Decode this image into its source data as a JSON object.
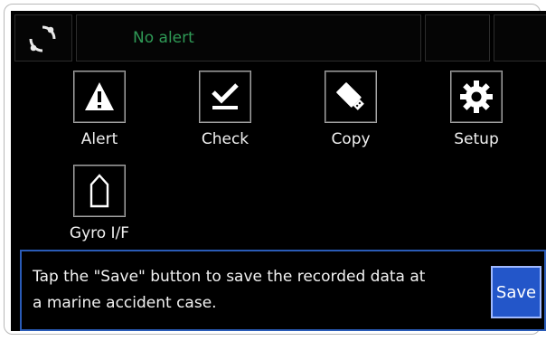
{
  "topbar": {
    "status_icon": "sync-indicator-icon",
    "alert_text": "No alert"
  },
  "menu": {
    "items": [
      {
        "label": "Alert",
        "icon": "warning-triangle-icon"
      },
      {
        "label": "Check",
        "icon": "checkmark-icon"
      },
      {
        "label": "Copy",
        "icon": "usb-drive-icon"
      },
      {
        "label": "Setup",
        "icon": "gear-icon"
      },
      {
        "label": "Gyro I/F",
        "icon": "ship-bow-icon"
      }
    ]
  },
  "message": {
    "text_line1": "Tap the \"Save\" button to save the recorded data at",
    "text_line2": "a marine accident case.",
    "save_label": "Save"
  },
  "colors": {
    "alert_text": "#2f9a56",
    "save_button": "#2356c9",
    "message_border": "#2a5bb7"
  }
}
